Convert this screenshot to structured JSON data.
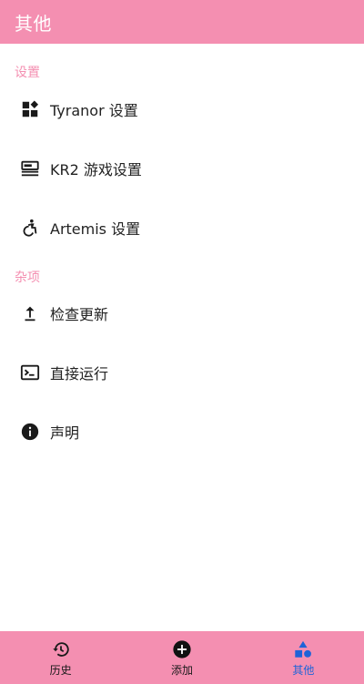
{
  "header": {
    "title": "其他"
  },
  "sections": [
    {
      "title": "设置",
      "items": [
        {
          "label": "Tyranor 设置",
          "icon": "dashboard-icon"
        },
        {
          "label": "KR2 游戏设置",
          "icon": "storage-icon"
        },
        {
          "label": "Artemis 设置",
          "icon": "accessible-icon"
        }
      ]
    },
    {
      "title": "杂项",
      "items": [
        {
          "label": "检查更新",
          "icon": "upload-icon"
        },
        {
          "label": "直接运行",
          "icon": "terminal-icon"
        },
        {
          "label": "声明",
          "icon": "info-icon"
        }
      ]
    }
  ],
  "bottom_nav": {
    "items": [
      {
        "label": "历史",
        "icon": "history-icon",
        "active": false
      },
      {
        "label": "添加",
        "icon": "add-circle-icon",
        "active": false
      },
      {
        "label": "其他",
        "icon": "category-icon",
        "active": true
      }
    ]
  },
  "colors": {
    "primary": "#f48fb1",
    "active_nav": "#1e63d8",
    "text": "#222222"
  }
}
